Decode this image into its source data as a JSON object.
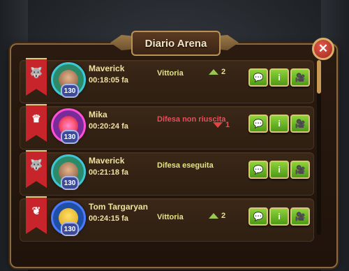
{
  "window": {
    "title": "Diario Arena"
  },
  "colors": {
    "accent_gold": "#d9c67b",
    "win_text": "#e4e38b",
    "fail_text": "#e3515d",
    "button_green": "#6db52a",
    "banner_red": "#c7252b"
  },
  "entries": [
    {
      "name": "Maverick",
      "time": "00:18:05 fa",
      "result": "Vittoria",
      "result_type": "win",
      "delta": "2",
      "delta_dir": "up",
      "level": "130",
      "avatar_icon": "goggles-hero-icon",
      "banner_icon": "wolf-emblem-icon"
    },
    {
      "name": "Mika",
      "time": "00:20:24 fa",
      "result": "Difesa non riuscita",
      "result_type": "fail",
      "delta": "1",
      "delta_dir": "down",
      "level": "130",
      "avatar_icon": "eye-monster-icon",
      "banner_icon": "crown-emblem-icon"
    },
    {
      "name": "Maverick",
      "time": "00:21:18 fa",
      "result": "Difesa eseguita",
      "result_type": "win",
      "delta": "",
      "delta_dir": "",
      "level": "130",
      "avatar_icon": "goggles-hero-icon",
      "banner_icon": "wolf-emblem-icon"
    },
    {
      "name": "Tom Targaryan",
      "time": "00:24:15 fa",
      "result": "Vittoria",
      "result_type": "win",
      "delta": "2",
      "delta_dir": "up",
      "level": "130",
      "avatar_icon": "bee-hero-icon",
      "banner_icon": "laurel-emblem-icon"
    }
  ],
  "buttons": {
    "chat": "chat-bubble-icon",
    "info": "i",
    "replay": "camera-icon"
  }
}
